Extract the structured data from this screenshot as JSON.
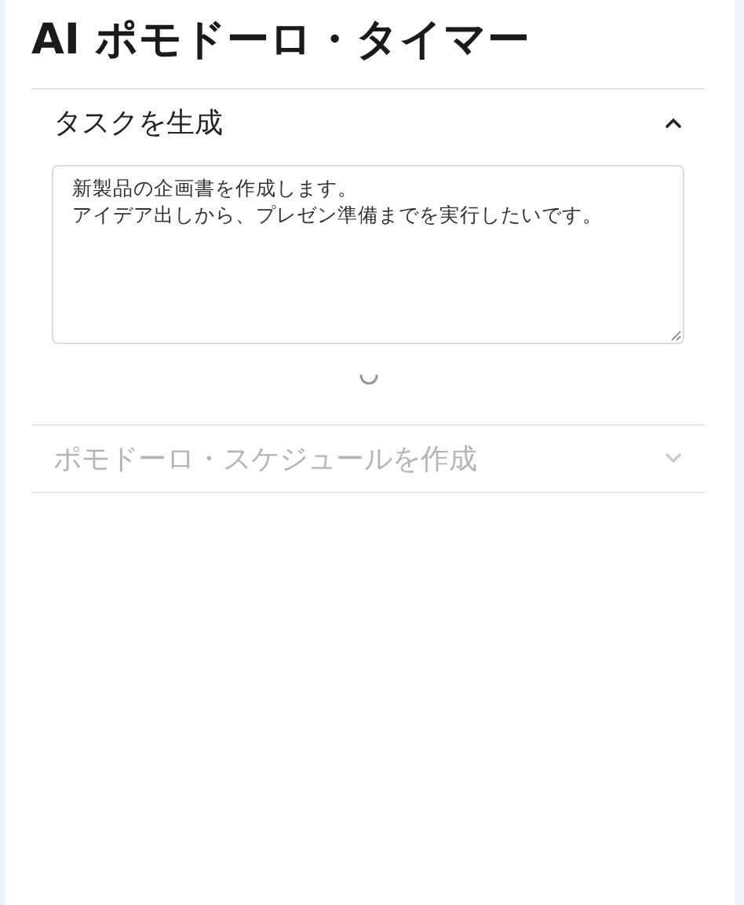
{
  "title": "AI ポモドーロ・タイマー",
  "sections": [
    {
      "title": "タスクを生成",
      "expanded": true,
      "disabled": false,
      "input": {
        "lines": [
          "新製品の企画書を作成します。",
          "アイデア出しから、プレゼン準備までを実行したいです。"
        ]
      },
      "loading": true
    },
    {
      "title": "ポモドーロ・スケジュールを作成",
      "expanded": false,
      "disabled": true
    }
  ]
}
